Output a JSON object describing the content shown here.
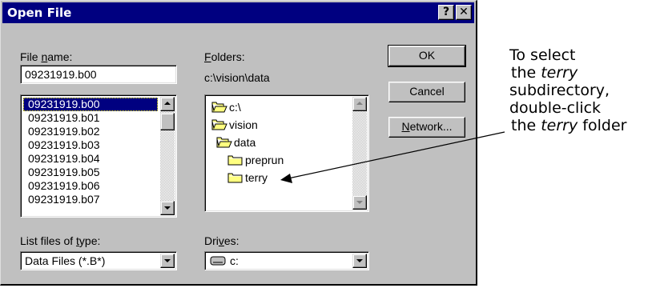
{
  "dialog": {
    "title": "Open File",
    "help_glyph": "?",
    "close_glyph": "✕"
  },
  "file_name": {
    "label_pre": "File ",
    "label_ul": "n",
    "label_post": "ame:",
    "value": "09231919.b00",
    "items": [
      "09231919.b00",
      "09231919.b01",
      "09231919.b02",
      "09231919.b03",
      "09231919.b04",
      "09231919.b05",
      "09231919.b06",
      "09231919.b07"
    ],
    "selected_index": 0
  },
  "folders": {
    "label_ul": "F",
    "label_post": "olders:",
    "path": "c:\\vision\\data",
    "items": [
      {
        "name": "c:\\",
        "icon": "open-folder-icon"
      },
      {
        "name": "vision",
        "icon": "open-folder-icon"
      },
      {
        "name": "data",
        "icon": "open-folder-icon"
      },
      {
        "name": "preprun",
        "icon": "closed-folder-icon"
      },
      {
        "name": "terry",
        "icon": "closed-folder-icon"
      }
    ]
  },
  "file_type": {
    "label_pre": "List files of ",
    "label_ul": "t",
    "label_post": "ype:",
    "value": "Data Files (*.B*)"
  },
  "drives": {
    "label_pre": "Dri",
    "label_ul": "v",
    "label_post": "es:",
    "value": "c:",
    "icon": "drive-icon"
  },
  "buttons": {
    "ok": "OK",
    "cancel": "Cancel",
    "network_ul": "N",
    "network_post": "etwork..."
  },
  "annotation": {
    "line1": "To select",
    "line2_pre": "the ",
    "line2_em": "terry",
    "line3": "subdirectory,",
    "line4": "double-click",
    "line5_pre": "the ",
    "line5_em": "terry",
    "line5_post": " folder"
  },
  "colors": {
    "titlebar": "#000080",
    "face": "#c0c0c0",
    "selection": "#000080",
    "folder": "#ffff80"
  }
}
